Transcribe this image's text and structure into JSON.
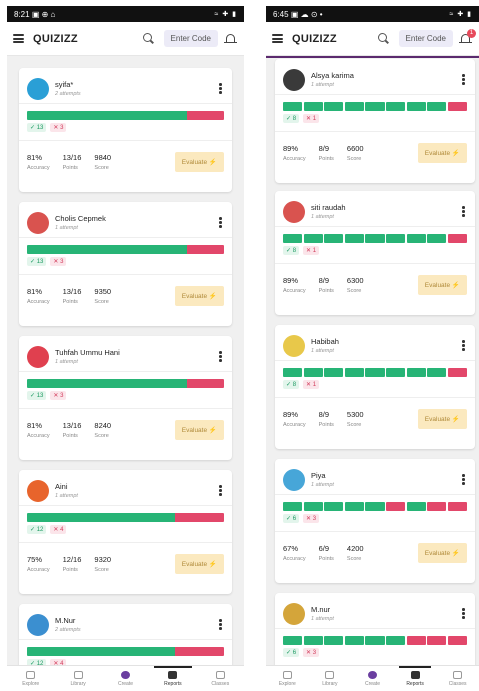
{
  "left": {
    "status_time": "8:21",
    "status_icons": "▣ ⊕ ⌂",
    "status_right": "≈ ✚ ▮",
    "notification_count": "",
    "students": [
      {
        "name": "syifa*",
        "attempts": "2 attempts",
        "correct": "✓ 13",
        "wrong": "✕ 3",
        "correct_fraction": 0.8125,
        "accuracy": "81%",
        "points": "13/16",
        "score": "9840",
        "avatar_color": "#2a9fd6"
      },
      {
        "name": "Cholis Cepmek",
        "attempts": "1 attempt",
        "correct": "✓ 13",
        "wrong": "✕ 3",
        "correct_fraction": 0.8125,
        "accuracy": "81%",
        "points": "13/16",
        "score": "9350",
        "avatar_color": "#d9534f"
      },
      {
        "name": "Tuhfah Ummu Hani",
        "attempts": "1 attempt",
        "correct": "✓ 13",
        "wrong": "✕ 3",
        "correct_fraction": 0.8125,
        "accuracy": "81%",
        "points": "13/16",
        "score": "8240",
        "avatar_color": "#e0404f"
      },
      {
        "name": "Aini",
        "attempts": "1 attempt",
        "correct": "✓ 12",
        "wrong": "✕ 4",
        "correct_fraction": 0.75,
        "accuracy": "75%",
        "points": "12/16",
        "score": "9320",
        "avatar_color": "#e8642c"
      },
      {
        "name": "M.Nur",
        "attempts": "2 attempts",
        "correct": "✓ 12",
        "wrong": "✕ 4",
        "correct_fraction": 0.75,
        "accuracy": "",
        "points": "",
        "score": "",
        "avatar_color": "#3b8fd0"
      }
    ]
  },
  "right": {
    "status_time": "6:45",
    "status_icons": "▣ ☁ ⊙ •",
    "status_right": "≈ ✚ ▮",
    "notification_count": "1",
    "students": [
      {
        "name": "Alsya karima",
        "attempts": "1 attempt",
        "correct": "✓ 8",
        "wrong": "✕ 1",
        "segments": [
          "g",
          "g",
          "g",
          "g",
          "g",
          "g",
          "g",
          "g",
          "r"
        ],
        "accuracy": "89%",
        "points": "8/9",
        "score": "6600",
        "avatar_color": "#3a3a3a"
      },
      {
        "name": "siti raudah",
        "attempts": "1 attempt",
        "correct": "✓ 8",
        "wrong": "✕ 1",
        "segments": [
          "g",
          "g",
          "g",
          "g",
          "g",
          "g",
          "g",
          "g",
          "r"
        ],
        "accuracy": "89%",
        "points": "8/9",
        "score": "6300",
        "avatar_color": "#d9534f"
      },
      {
        "name": "Habibah",
        "attempts": "1 attempt",
        "correct": "✓ 8",
        "wrong": "✕ 1",
        "segments": [
          "g",
          "g",
          "g",
          "g",
          "g",
          "g",
          "g",
          "g",
          "r"
        ],
        "accuracy": "89%",
        "points": "8/9",
        "score": "5300",
        "avatar_color": "#e8c84a"
      },
      {
        "name": "Piya",
        "attempts": "1 attempt",
        "correct": "✓ 6",
        "wrong": "✕ 3",
        "segments": [
          "g",
          "g",
          "g",
          "g",
          "g",
          "r",
          "g",
          "r",
          "r"
        ],
        "accuracy": "67%",
        "points": "6/9",
        "score": "4200",
        "avatar_color": "#47a6d8"
      },
      {
        "name": "M.nur",
        "attempts": "1 attempt",
        "correct": "✓ 6",
        "wrong": "✕ 3",
        "segments": [
          "g",
          "g",
          "g",
          "g",
          "g",
          "g",
          "r",
          "r",
          "r"
        ],
        "accuracy": "",
        "points": "",
        "score": "",
        "avatar_color": "#d4a53a"
      }
    ]
  },
  "common": {
    "logo": "QUIZIZZ",
    "enter_code": "Enter Code",
    "accuracy_label": "Accuracy",
    "points_label": "Points",
    "score_label": "Score",
    "evaluate_label": "Evaluate ⚡",
    "nav": [
      "Explore",
      "Library",
      "Create",
      "Reports",
      "Classes"
    ],
    "active_nav": "Reports",
    "colors": {
      "green": "#27b476",
      "red": "#e2476a",
      "purple": "#5b2a6e",
      "evaluate_bg": "#fbe9bf"
    }
  }
}
